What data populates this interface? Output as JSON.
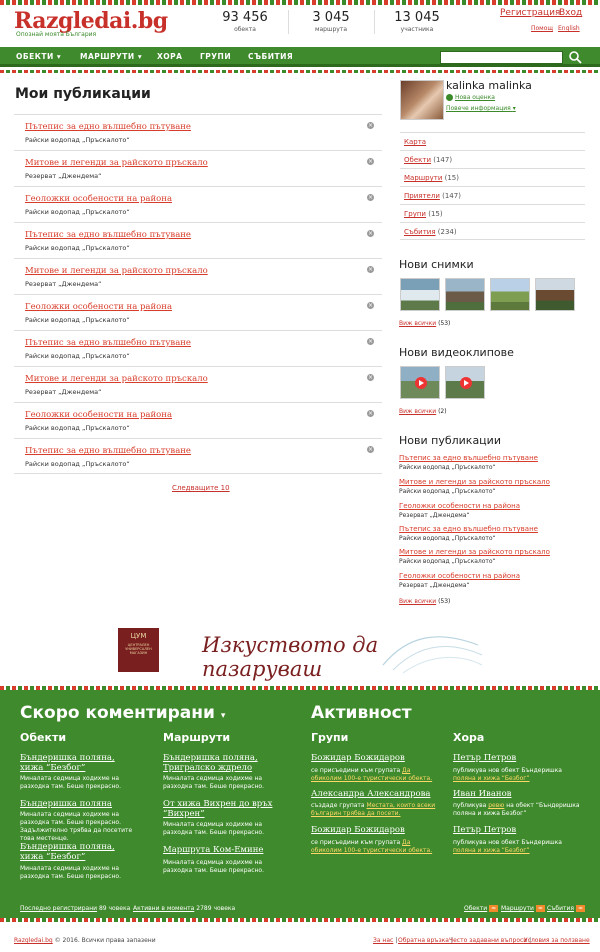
{
  "header": {
    "logo": "Razgledai.bg",
    "tagline": "Опознай моята България",
    "stats": [
      {
        "number": "93 456",
        "label": "обекта"
      },
      {
        "number": "3 045",
        "label": "маршрута"
      },
      {
        "number": "13 045",
        "label": "участника"
      }
    ],
    "register": "Регистрация",
    "login": "Вход",
    "help": "Помощ",
    "english": "English"
  },
  "nav": {
    "items": [
      "ОБЕКТИ",
      "МАРШРУТИ",
      "ХОРА",
      "ГРУПИ",
      "СЪБИТИЯ"
    ],
    "search_placeholder": ""
  },
  "main": {
    "title": "Мои публикации",
    "publications": [
      {
        "title": "Пътепис за едно вълшебно пътуване",
        "sub": "Райски водопад „Пръскалото“"
      },
      {
        "title": "Митове и легенди за райското пръскало",
        "sub": "Резерват „Джендема“"
      },
      {
        "title": "Геоложки особености на района",
        "sub": "Райски водопад „Пръскалото“"
      },
      {
        "title": "Пътепис за едно вълшебно пътуване",
        "sub": "Райски водопад „Пръскалото“"
      },
      {
        "title": "Митове и легенди за райското пръскало",
        "sub": "Резерват „Джендема“"
      },
      {
        "title": "Геоложки особености на района",
        "sub": "Райски водопад „Пръскалото“"
      },
      {
        "title": "Пътепис за едно вълшебно пътуване",
        "sub": "Райски водопад „Пръскалото“"
      },
      {
        "title": "Митове и легенди за райското пръскало",
        "sub": "Резерват „Джендема“"
      },
      {
        "title": "Геоложки особености на района",
        "sub": "Райски водопад „Пръскалото“"
      },
      {
        "title": "Пътепис за едно вълшебно пътуване",
        "sub": "Райски водопад „Пръскалото“"
      }
    ],
    "next": "Следващите 10"
  },
  "sidebar": {
    "user_name": "kalinka malinka",
    "new_message": "Нова оценка",
    "more_info": "Повече информация",
    "links": [
      {
        "label": "Карта",
        "count": ""
      },
      {
        "label": "Обекти",
        "count": "(147)"
      },
      {
        "label": "Маршрути",
        "count": "(15)"
      },
      {
        "label": "Приятели",
        "count": "(147)"
      },
      {
        "label": "Групи",
        "count": "(15)"
      },
      {
        "label": "Събития",
        "count": "(234)"
      }
    ],
    "photos_title": "Нови снимки",
    "photos_link": "Виж всички",
    "photos_count": "(53)",
    "videos_title": "Нови видеоклипове",
    "videos_link": "Виж всички",
    "videos_count": "(2)",
    "pubs_title": "Нови публикации",
    "pubs": [
      {
        "title": "Пътепис за едно вълшебно пътуване",
        "sub": "Райски водопад „Пръскалото“"
      },
      {
        "title": "Митове и легенди за райското пръскало",
        "sub": "Райски водопад „Пръскалото“"
      },
      {
        "title": "Геоложки особености на района",
        "sub": "Резерват „Джендема“"
      },
      {
        "title": "Пътепис за едно вълшебно пътуване",
        "sub": "Райски водопад „Пръскалото“"
      },
      {
        "title": "Митове и легенди за райското пръскало",
        "sub": "Райски водопад „Пръскалото“"
      },
      {
        "title": "Геоложки особености на района",
        "sub": "Резерват „Джендема“"
      }
    ],
    "pubs_link": "Виж всички",
    "pubs_count": "(53)"
  },
  "banner": {
    "logo_text": "ЦУМ",
    "logo_sub": "ЦЕНТРАЛЕН УНИВЕРСАЛЕН МАГАЗИН",
    "slogan": "Изкуството да пазаруваш"
  },
  "footer": {
    "recent_title": "Скоро коментирани",
    "activity_title": "Активност",
    "col_objects": "Обекти",
    "col_routes": "Маршрути",
    "col_groups": "Групи",
    "col_people": "Хора",
    "objects": [
      {
        "name": "Бъндеришка поляна, хижа “Безбог”",
        "desc": "Миналата седмица ходихме на разходка там. Беше прекрасно."
      },
      {
        "name": "Бъндеришка поляна",
        "desc": "Миналата седмица ходихме на разходка там. Беше прекрасно. Задължително трябва да посетите това местенце."
      },
      {
        "name": "Бъндеришка поляна, хижа “Безбог”",
        "desc": "Миналата седмица ходихме на разходка там. Беше прекрасно."
      }
    ],
    "routes": [
      {
        "name": "Бъндеришка поляна, Тригралско ждрело",
        "desc": "Миналата седмица ходихме на разходка там. Беше прекрасно."
      },
      {
        "name": "От хижа Вихрен до връх “Вихрен”",
        "desc": "Миналата седмица ходихме на разходка там. Беше прекрасно."
      },
      {
        "name": "Маршрута Ком-Емине",
        "desc": "Миналата седмица ходихме на разходка там. Беше прекрасно."
      }
    ],
    "groups": [
      {
        "name": "Божидар Божидаров",
        "pre": "се присъедини към групата",
        "link": "Да обиколим 100-е туристически обекта."
      },
      {
        "name": "Александра Александрова",
        "pre": "създаде групата",
        "link": "Местата, които всеки българин трябва да посети."
      },
      {
        "name": "Божидар Божидаров",
        "pre": "се присъедини към групата",
        "link": "Да обиколим 100-е туристически обекта."
      }
    ],
    "people": [
      {
        "name": "Петър Петров",
        "pre": "публикува нов обект Бъндеришка",
        "link": "поляна и хижа “Безбог”"
      },
      {
        "name": "Иван Иванов",
        "pre": "публикува",
        "link": "ревю",
        "post": "на обект “Бъндеришка поляна и хижа Безбог”"
      },
      {
        "name": "Петър Петров",
        "pre": "публикува нов обект Бъндеришка",
        "link": "поляна и хижа “Безбог”"
      }
    ],
    "last_registered": "Последно регистрирани",
    "last_registered_count": "89 човека",
    "active_now": "Активни в момента",
    "active_now_count": "2789 човека",
    "rss": [
      "Обекти",
      "Маршрути",
      "Събития"
    ]
  },
  "bottom": {
    "copyright_site": "Razgledai.bg",
    "copyright": "© 2016. Всички права запазени",
    "links": [
      "За нас",
      "Обратна връзка",
      "Често задавани въпроси",
      "Условия за ползване"
    ]
  }
}
